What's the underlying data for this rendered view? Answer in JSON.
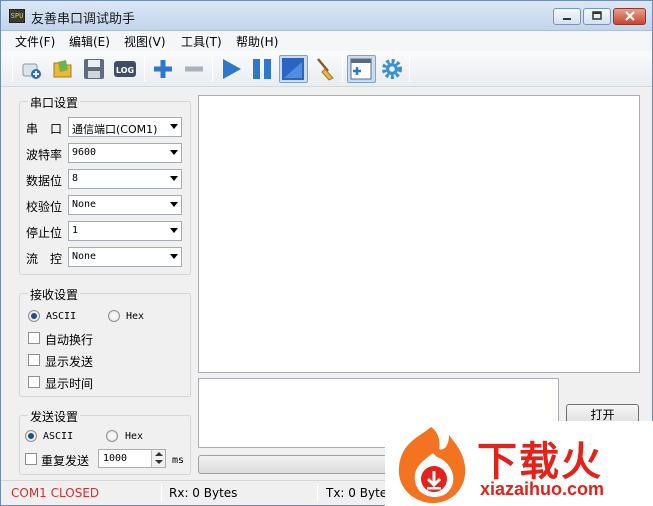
{
  "window": {
    "title": "友善串口调试助手",
    "app_icon_text": "SPU"
  },
  "menu": [
    "文件(F)",
    "编辑(E)",
    "视图(V)",
    "工具(T)",
    "帮助(H)"
  ],
  "toolbar": {
    "log_label": "LOG",
    "icons": [
      "new-session-icon",
      "open-folder-icon",
      "save-icon",
      "log-icon",
      "add-icon",
      "remove-icon",
      "play-icon",
      "pause-icon",
      "window-icon",
      "broom-icon",
      "toggle-panel-icon",
      "settings-gear-icon"
    ]
  },
  "serial_settings": {
    "title": "串口设置",
    "rows": [
      {
        "label": "串　口",
        "value": "通信端口(COM1)"
      },
      {
        "label": "波特率",
        "value": "9600"
      },
      {
        "label": "数据位",
        "value": "8"
      },
      {
        "label": "校验位",
        "value": "None"
      },
      {
        "label": "停止位",
        "value": "1"
      },
      {
        "label": "流　控",
        "value": "None"
      }
    ]
  },
  "receive_settings": {
    "title": "接收设置",
    "ascii_label": "ASCII",
    "hex_label": "Hex",
    "selected": "ASCII",
    "auto_wrap": "自动换行",
    "show_send": "显示发送",
    "show_time": "显示时间"
  },
  "send_settings": {
    "title": "发送设置",
    "ascii_label": "ASCII",
    "hex_label": "Hex",
    "selected": "ASCII",
    "repeat_label": "重复发送",
    "interval": "1000",
    "unit": "ms"
  },
  "open_button": "打开",
  "status": {
    "port_state": "COM1 CLOSED",
    "rx": "Rx: 0 Bytes",
    "tx": "Tx: 0 Bytes",
    "port_state_color": "#d32f2f"
  },
  "watermark": {
    "brand": "下载火",
    "url": "xiazaihuo.com",
    "color": "#e2231a"
  }
}
